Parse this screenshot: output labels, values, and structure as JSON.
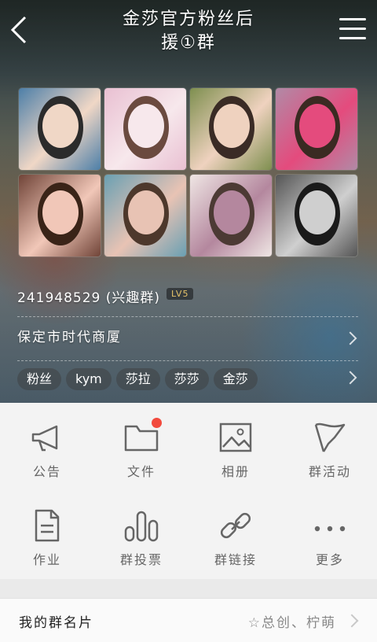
{
  "header": {
    "title_line1": "金莎官方粉丝后",
    "title_line2": "援①群"
  },
  "photos": [
    {
      "name": "photo-1",
      "palette": [
        "#4d7fa8",
        "#f0d7c6",
        "#2b2b2b"
      ]
    },
    {
      "name": "photo-2",
      "palette": [
        "#e9c0d2",
        "#f7e8ec",
        "#6b4a3f"
      ]
    },
    {
      "name": "photo-3",
      "palette": [
        "#7e8f4f",
        "#efd2bf",
        "#3a2b25"
      ]
    },
    {
      "name": "photo-4",
      "palette": [
        "#b18aa6",
        "#e44b7d",
        "#3a2a22"
      ]
    },
    {
      "name": "photo-5",
      "palette": [
        "#704438",
        "#f1c7b8",
        "#3a2418"
      ]
    },
    {
      "name": "photo-6",
      "palette": [
        "#6aa0b3",
        "#e8c3b4",
        "#4d382c"
      ]
    },
    {
      "name": "photo-7",
      "palette": [
        "#efe6e4",
        "#b4879e",
        "#4c3a34"
      ]
    },
    {
      "name": "photo-8",
      "palette": [
        "#555555",
        "#cfcfcf",
        "#1a1a1a"
      ]
    }
  ],
  "group": {
    "id_text": "241948529 (兴趣群)",
    "level": "LV5",
    "address": "保定市时代商厦",
    "tags": [
      "粉丝",
      "kym",
      "莎拉",
      "莎莎",
      "金莎"
    ]
  },
  "functions": [
    {
      "label": "公告",
      "icon": "megaphone-icon"
    },
    {
      "label": "文件",
      "icon": "folder-icon",
      "badge": true
    },
    {
      "label": "相册",
      "icon": "image-icon"
    },
    {
      "label": "群活动",
      "icon": "flag-icon"
    },
    {
      "label": "作业",
      "icon": "document-icon"
    },
    {
      "label": "群投票",
      "icon": "bar-chart-icon"
    },
    {
      "label": "群链接",
      "icon": "link-icon"
    },
    {
      "label": "更多",
      "icon": "more-icon"
    }
  ],
  "my_card": {
    "label": "我的群名片",
    "value": "☆总创、柠萌"
  },
  "colors": {
    "badge": "#f24a3d",
    "icon_stroke": "#666666",
    "level_text": "#e6c36a"
  }
}
